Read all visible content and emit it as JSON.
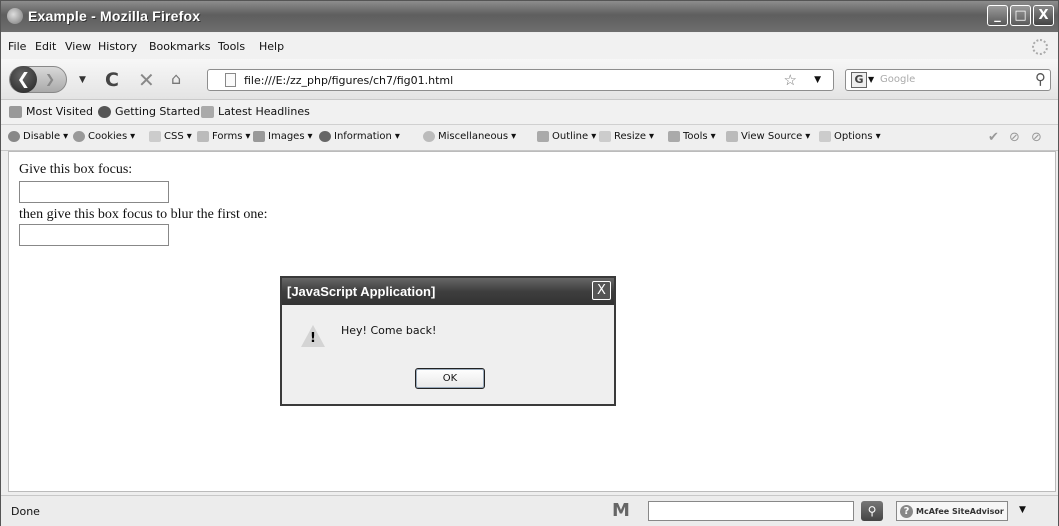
{
  "window": {
    "title": "Example - Mozilla Firefox",
    "buttons": {
      "minimize": "_",
      "maximize": "□",
      "close": "X"
    }
  },
  "menubar": {
    "items": [
      "File",
      "Edit",
      "View",
      "History",
      "Bookmarks",
      "Tools",
      "Help"
    ]
  },
  "navbar": {
    "back": "❮",
    "forward": "❯",
    "reload": "C",
    "stop": "✕",
    "home": "⌂",
    "url": "file:///E:/zz_php/figures/ch7/fig01.html",
    "star": "☆",
    "search_engine": "G",
    "search_placeholder": "Google",
    "search_icon": "⚲"
  },
  "bookmarks": {
    "items": [
      "Most Visited",
      "Getting Started",
      "Latest Headlines"
    ]
  },
  "webdev_toolbar": {
    "items": [
      "Disable",
      "Cookies",
      "CSS",
      "Forms",
      "Images",
      "Information",
      "Miscellaneous",
      "Outline",
      "Resize",
      "Tools",
      "View Source",
      "Options"
    ],
    "right_icons": [
      "✔",
      "⊘",
      "⊘"
    ]
  },
  "content": {
    "label1": "Give this box focus:",
    "label2": "then give this box focus to blur the first one:"
  },
  "dialog": {
    "title": "[JavaScript Application]",
    "close": "X",
    "warning_mark": "!",
    "message": "Hey! Come back!",
    "ok": "OK"
  },
  "statusbar": {
    "status": "Done",
    "m_logo": "M",
    "search_button": "⚲",
    "siteadvisor_q": "?",
    "siteadvisor": "McAfee SiteAdvisor",
    "dropdown": "▼"
  }
}
